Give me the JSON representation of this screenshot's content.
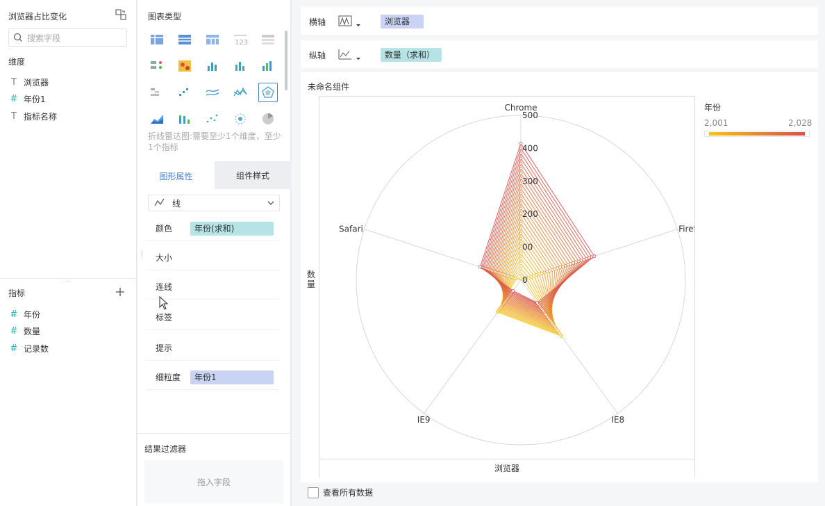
{
  "left": {
    "title": "浏览器占比变化",
    "search_placeholder": "搜索字段",
    "dimension_heading": "维度",
    "dimensions": [
      {
        "label": "浏览器",
        "icon": "text-field-icon",
        "glyph": "T"
      },
      {
        "label": "年份1",
        "icon": "number-as-dimension-icon",
        "glyph": "#"
      },
      {
        "label": "指标名称",
        "icon": "text-special-field-icon",
        "glyph": "T"
      }
    ],
    "metric_heading": "指标",
    "metrics": [
      {
        "label": "年份",
        "icon": "number-field-icon",
        "glyph": "#"
      },
      {
        "label": "数量",
        "icon": "number-field-icon",
        "glyph": "#"
      },
      {
        "label": "记录数",
        "icon": "record-count-icon",
        "glyph": "#"
      }
    ]
  },
  "mid": {
    "chart_type_heading": "图表类型",
    "chart_hint": "折线雷达图:需要至少1个维度，至少1个指标",
    "tabs": [
      {
        "label": "图形属性"
      },
      {
        "label": "组件样式"
      }
    ],
    "mark_type": "线",
    "props": {
      "color_label": "颜色",
      "color_value": "年份(求和)",
      "size_label": "大小",
      "connect_label": "连线",
      "label_label": "标签",
      "tooltip_label": "提示",
      "granularity_label": "细粒度",
      "granularity_value": "年份1"
    },
    "filter_heading": "结果过滤器",
    "filter_drop": "拖入字段"
  },
  "right": {
    "x_axis_label": "横轴",
    "x_axis_field": "浏览器",
    "y_axis_label": "纵轴",
    "y_axis_field": "数量（求和）",
    "component_title": "未命名组件",
    "y_title": "数量",
    "x_title": "浏览器",
    "legend_title": "年份",
    "legend_min": "2,001",
    "legend_max": "2,028",
    "show_all_label": "查看所有数据"
  },
  "colors": {
    "accent": "#3d7fd1",
    "teal_pill": "#b6e3e6",
    "blue_pill": "#c9d3f3",
    "gradient_start": "#f5c518",
    "gradient_end": "#d94f4f"
  },
  "chart_data": {
    "type": "radar",
    "axes": [
      "Chrome",
      "Firefox",
      "IE8",
      "IE9",
      "Safari"
    ],
    "r_ticks": [
      "0",
      "00",
      "200",
      "300",
      "400",
      "500"
    ],
    "rmax": 500,
    "color_by": "年份",
    "year_range": [
      2001,
      2028
    ],
    "series": [
      {
        "year": 2001,
        "values": [
          5,
          8,
          210,
          120,
          15
        ]
      },
      {
        "year": 2028,
        "values": [
          415,
          235,
          85,
          40,
          130
        ]
      }
    ]
  }
}
